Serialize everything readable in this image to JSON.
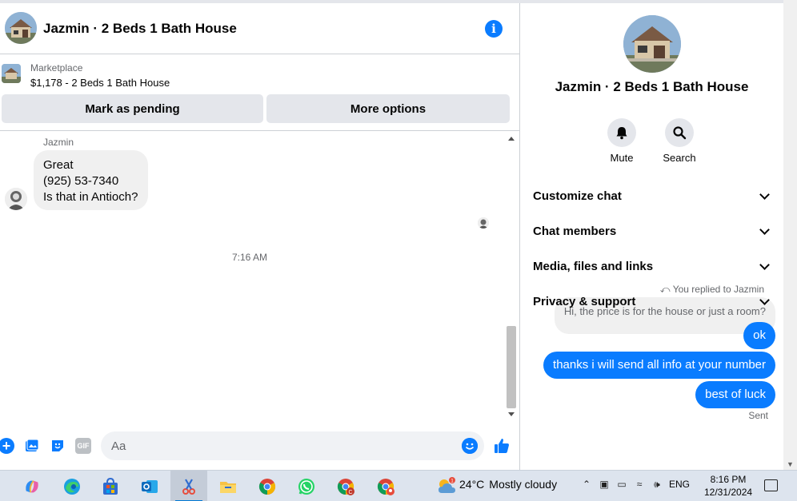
{
  "header": {
    "title": "Jazmin · 2 Beds 1 Bath House",
    "info_icon": "info-icon"
  },
  "marketplace": {
    "source": "Marketplace",
    "listing": "$1,178 - 2 Beds 1 Bath House",
    "mark_pending_label": "Mark as pending",
    "more_options_label": "More options"
  },
  "messages": {
    "sender_name": "Jazmin",
    "incoming_lines": [
      "Great",
      "(925) 53-7340",
      "Is that in Antioch?"
    ],
    "timestamp": "7:16 AM",
    "reply_note": "You replied to Jazmin",
    "quoted_text": "Hi, the price is for the house or just a room?",
    "outgoing": [
      "ok",
      "thanks i will send all info at your number",
      "best of luck"
    ],
    "status": "Sent"
  },
  "composer": {
    "placeholder": "Aa",
    "icons": [
      "plus-icon",
      "image-icon",
      "sticker-icon",
      "gif-icon",
      "emoji-icon",
      "thumbs-up-icon"
    ],
    "gif_label": "GIF"
  },
  "panel": {
    "title": "Jazmin · 2 Beds 1 Bath House",
    "mute_label": "Mute",
    "search_label": "Search",
    "sections": [
      "Customize chat",
      "Chat members",
      "Media, files and links",
      "Privacy & support"
    ]
  },
  "taskbar": {
    "weather_temp": "24°C",
    "weather_text": "Mostly cloudy",
    "weather_badge": "1",
    "language": "ENG",
    "time": "8:16 PM",
    "date": "12/31/2024",
    "apps": [
      "copilot",
      "edge",
      "store",
      "outlook",
      "snipping-tool",
      "file-explorer",
      "chrome",
      "whatsapp",
      "chrome-profile-c",
      "chrome-profile-2"
    ],
    "accent": "#0078d4"
  },
  "colors": {
    "messenger_blue": "#0a7cff",
    "bubble_gray": "#f0f0f0"
  }
}
